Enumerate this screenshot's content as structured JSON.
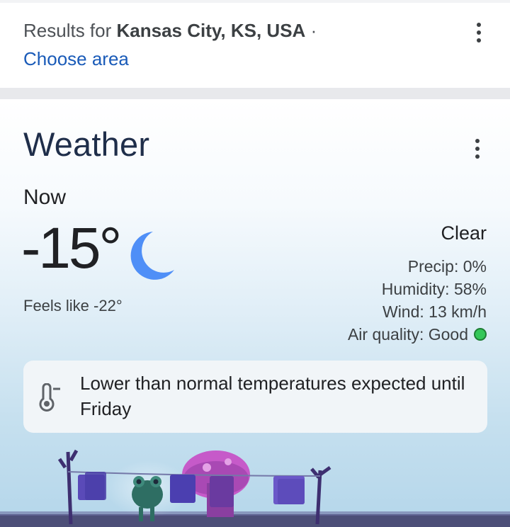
{
  "results": {
    "prefix": "Results for",
    "location": "Kansas City, KS, USA",
    "separator": "·",
    "choose_area": "Choose area"
  },
  "weather": {
    "title": "Weather",
    "now_label": "Now",
    "temperature": "-15°",
    "feels_like": "Feels like -22°",
    "condition": "Clear",
    "condition_icon": "moon-icon",
    "stats": [
      {
        "label": "Precip:",
        "value": "0%"
      },
      {
        "label": "Humidity:",
        "value": "58%"
      },
      {
        "label": "Wind:",
        "value": "13 km/h"
      }
    ],
    "air_quality": {
      "label": "Air quality:",
      "value": "Good",
      "color": "#34c759"
    },
    "alert": {
      "icon": "thermometer-down-icon",
      "text": "Lower than normal temperatures expected until Friday"
    }
  },
  "colors": {
    "link": "#1a5bb8",
    "title": "#1f2e4a",
    "moon": "#4f8ff7"
  }
}
